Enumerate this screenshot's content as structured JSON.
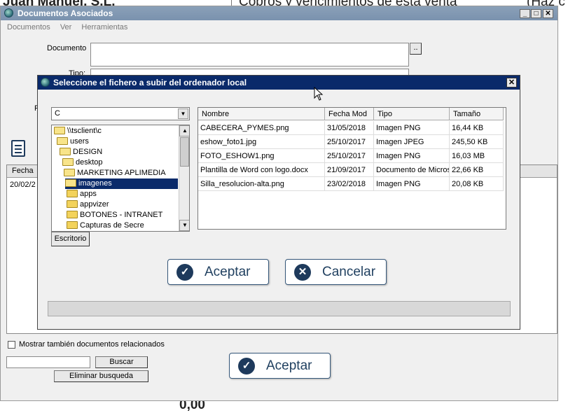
{
  "background": {
    "top_left_partial": "Juan Manuel, S.L.",
    "top_right_partial": "Cobros y vencimientos de esta venta",
    "top_far_right_partial": "(Haz c",
    "bottom_partial": "0,00"
  },
  "outer_window": {
    "title": "Documentos Asociados",
    "menu": [
      "Documentos",
      "Ver",
      "Herramientas"
    ],
    "documento_label": "Documento",
    "tipo_label": "Tipo:",
    "f_label": "F",
    "browse_label": "..",
    "grid_header": "Fecha",
    "grid_row_date": "20/02/2",
    "mostrar_label": "Mostrar también documentos relacionados",
    "buscar_label": "Buscar",
    "eliminar_label": "Eliminar busqueda",
    "aceptar_label": "Aceptar"
  },
  "dialog": {
    "title": "Seleccione el fichero a subir del ordenador local",
    "drive": "C",
    "tree": [
      {
        "label": "\\\\tsclient\\c",
        "selected": false
      },
      {
        "label": "users",
        "selected": false
      },
      {
        "label": "DESIGN",
        "selected": false
      },
      {
        "label": "desktop",
        "selected": false
      },
      {
        "label": "MARKETING APLIMEDIA",
        "selected": false
      },
      {
        "label": "imagenes",
        "selected": true
      },
      {
        "label": "apps",
        "selected": false
      },
      {
        "label": "appvizer",
        "selected": false
      },
      {
        "label": "BOTONES - INTRANET",
        "selected": false
      },
      {
        "label": "Capturas de Secre",
        "selected": false
      }
    ],
    "escritorio_label": "Escritorio",
    "columns": [
      "Nombre",
      "Fecha Mod",
      "Tipo",
      "Tamaño"
    ],
    "files": [
      {
        "nombre": "CABECERA_PYMES.png",
        "fecha": "31/05/2018",
        "tipo": "Imagen PNG",
        "tamano": "16,44 KB"
      },
      {
        "nombre": "eshow_foto1.jpg",
        "fecha": "25/10/2017",
        "tipo": "Imagen JPEG",
        "tamano": "245,50 KB"
      },
      {
        "nombre": "FOTO_ESHOW1.png",
        "fecha": "25/10/2017",
        "tipo": "Imagen PNG",
        "tamano": "16,03 MB"
      },
      {
        "nombre": "Plantilla de Word con logo.docx",
        "fecha": "21/09/2017",
        "tipo": "Documento de Micros",
        "tamano": "22,66 KB"
      },
      {
        "nombre": "Silla_resolucion-alta.png",
        "fecha": "23/02/2018",
        "tipo": "Imagen PNG",
        "tamano": "20,08 KB"
      }
    ],
    "aceptar_label": "Aceptar",
    "cancelar_label": "Cancelar"
  }
}
